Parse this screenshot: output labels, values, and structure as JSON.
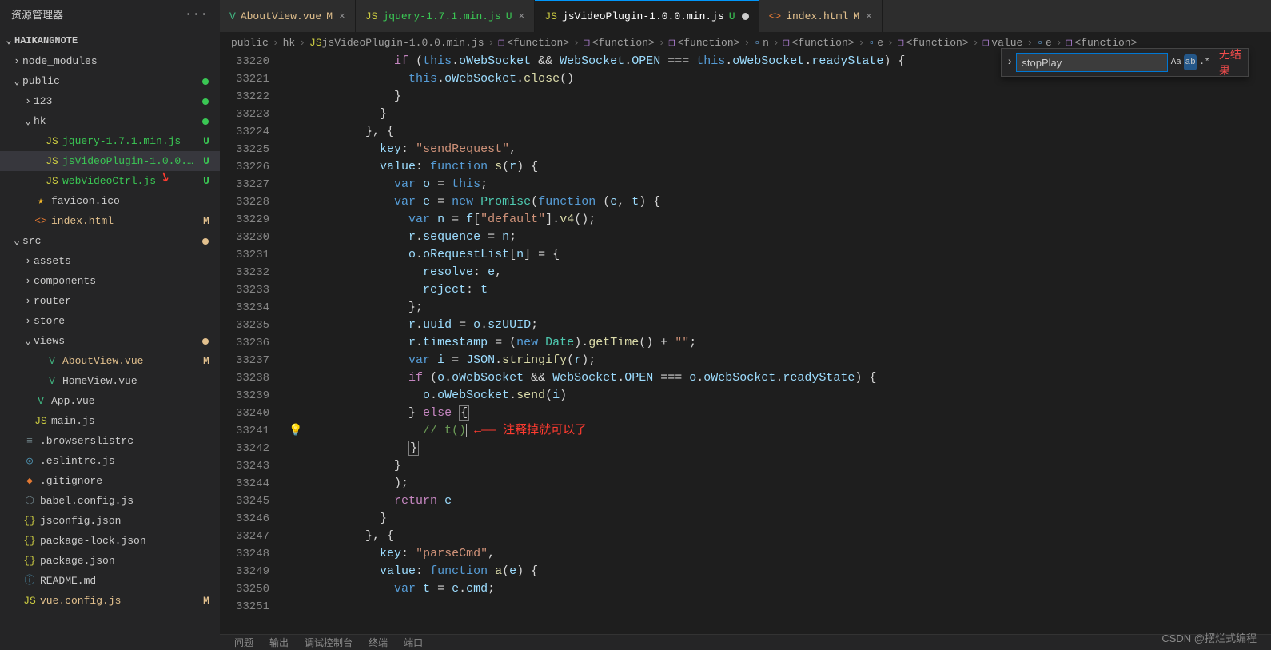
{
  "side": {
    "title": "资源管理器",
    "project": "HAIKANGNOTE",
    "tree": [
      {
        "ind": 14,
        "chev": "›",
        "icon": "",
        "name": "node_modules",
        "color": "",
        "badge": "",
        "dot": ""
      },
      {
        "ind": 14,
        "chev": "⌄",
        "icon": "",
        "name": "public",
        "color": "",
        "badge": "",
        "dot": "#3ac754"
      },
      {
        "ind": 28,
        "chev": "›",
        "icon": "",
        "name": "123",
        "color": "",
        "badge": "",
        "dot": "#3ac754"
      },
      {
        "ind": 28,
        "chev": "⌄",
        "icon": "",
        "name": "hk",
        "color": "",
        "badge": "",
        "dot": "#3ac754"
      },
      {
        "ind": 42,
        "chev": "",
        "icon": "JS",
        "iconcls": "js",
        "name": "jquery-1.7.1.min.js",
        "badge": "U",
        "bcolor": "#3ac754",
        "fg": "#3ac754"
      },
      {
        "ind": 42,
        "chev": "",
        "icon": "JS",
        "iconcls": "js",
        "name": "jsVideoPlugin-1.0.0.min.js",
        "badge": "U",
        "bcolor": "#3ac754",
        "fg": "#3ac754",
        "sel": true,
        "arrow": true
      },
      {
        "ind": 42,
        "chev": "",
        "icon": "JS",
        "iconcls": "js",
        "name": "webVideoCtrl.js",
        "badge": "U",
        "bcolor": "#3ac754",
        "fg": "#3ac754"
      },
      {
        "ind": 28,
        "chev": "",
        "icon": "★",
        "iconcls": "star",
        "name": "favicon.ico"
      },
      {
        "ind": 28,
        "chev": "",
        "icon": "<>",
        "iconcls": "orangef",
        "name": "index.html",
        "badge": "M",
        "bcolor": "#e2c08d",
        "fg": "#e2c08d"
      },
      {
        "ind": 14,
        "chev": "⌄",
        "icon": "",
        "name": "src",
        "badge": "",
        "dot": "#e2c08d"
      },
      {
        "ind": 28,
        "chev": "›",
        "icon": "",
        "name": "assets"
      },
      {
        "ind": 28,
        "chev": "›",
        "icon": "",
        "name": "components"
      },
      {
        "ind": 28,
        "chev": "›",
        "icon": "",
        "name": "router"
      },
      {
        "ind": 28,
        "chev": "›",
        "icon": "",
        "name": "store"
      },
      {
        "ind": 28,
        "chev": "⌄",
        "icon": "",
        "name": "views",
        "dot": "#e2c08d"
      },
      {
        "ind": 42,
        "chev": "",
        "icon": "V",
        "iconcls": "vue",
        "name": "AboutView.vue",
        "badge": "M",
        "bcolor": "#e2c08d",
        "fg": "#e2c08d"
      },
      {
        "ind": 42,
        "chev": "",
        "icon": "V",
        "iconcls": "vue",
        "name": "HomeView.vue"
      },
      {
        "ind": 28,
        "chev": "",
        "icon": "V",
        "iconcls": "vue",
        "name": "App.vue"
      },
      {
        "ind": 28,
        "chev": "",
        "icon": "JS",
        "iconcls": "js",
        "name": "main.js"
      },
      {
        "ind": 14,
        "chev": "",
        "icon": "≡",
        "iconcls": "gearc",
        "name": ".browserslistrc"
      },
      {
        "ind": 14,
        "chev": "",
        "icon": "◎",
        "iconcls": "oc",
        "name": ".eslintrc.js"
      },
      {
        "ind": 14,
        "chev": "",
        "icon": "◆",
        "iconcls": "orangef",
        "name": ".gitignore"
      },
      {
        "ind": 14,
        "chev": "",
        "icon": "⬡",
        "iconcls": "gearc",
        "name": "babel.config.js"
      },
      {
        "ind": 14,
        "chev": "",
        "icon": "{}",
        "iconcls": "brace",
        "name": "jsconfig.json"
      },
      {
        "ind": 14,
        "chev": "",
        "icon": "{}",
        "iconcls": "brace",
        "name": "package-lock.json"
      },
      {
        "ind": 14,
        "chev": "",
        "icon": "{}",
        "iconcls": "brace",
        "name": "package.json"
      },
      {
        "ind": 14,
        "chev": "",
        "icon": "ⓘ",
        "iconcls": "mdc",
        "name": "README.md"
      },
      {
        "ind": 14,
        "chev": "",
        "icon": "JS",
        "iconcls": "js",
        "name": "vue.config.js",
        "badge": "M",
        "bcolor": "#e2c08d",
        "fg": "#e2c08d"
      }
    ]
  },
  "tabs": [
    {
      "icon": "V",
      "iconcls": "vue",
      "name": "AboutView.vue",
      "sfx": "M",
      "sfxcolor": "#e2c08d",
      "close": "×",
      "fg": "#e2c08d"
    },
    {
      "icon": "JS",
      "iconcls": "js",
      "name": "jquery-1.7.1.min.js",
      "sfx": "U",
      "sfxcolor": "#3ac754",
      "close": "×",
      "fg": "#3ac754"
    },
    {
      "icon": "JS",
      "iconcls": "js",
      "name": "jsVideoPlugin-1.0.0.min.js",
      "sfx": "U",
      "sfxcolor": "#3ac754",
      "mod": true,
      "active": true,
      "fg": "#ffffff"
    },
    {
      "icon": "<>",
      "iconcls": "orangef",
      "name": "index.html",
      "sfx": "M",
      "sfxcolor": "#e2c08d",
      "close": "×",
      "fg": "#e2c08d"
    }
  ],
  "crumbs": [
    "public",
    "hk",
    "jsVideoPlugin-1.0.0.min.js",
    "<function>",
    "<function>",
    "<function>",
    "n",
    "<function>",
    "e",
    "<function>",
    "value",
    "e",
    "<function>"
  ],
  "search": {
    "value": "stopPlay",
    "opts": [
      "Aa",
      "ab",
      ".*"
    ],
    "nores": "无结果"
  },
  "lines_start": 33220,
  "lines": [
    "            <kw>if</kw> <p>(</p><this>this</this><p>.</p><prop>oWebSocket</prop> <p>&amp;&amp;</p> <prop>WebSocket</prop><p>.</p><prop>OPEN</prop> <p>===</p> <this>this</this><p>.</p><prop>oWebSocket</prop><p>.</p><prop>readyState</prop><p>) {</p>",
    "              <this>this</this><p>.</p><prop>oWebSocket</prop><p>.</p><def>close</def><p>()</p>",
    "            <p>}</p>",
    "          <p>}</p>",
    "        <p>}, {</p>",
    "          <prop>key</prop><p>:</p> <str>\"sendRequest\"</str><p>,</p>",
    "          <prop>value</prop><p>:</p> <kw2>function</kw2> <def>s</def><p>(</p><prop>r</prop><p>) {</p>",
    "            <kw2>var</kw2> <prop>o</prop> <p>=</p> <this>this</this><p>;</p>",
    "            <kw2>var</kw2> <prop>e</prop> <p>=</p> <kw2>new</kw2> <cls>Promise</cls><p>(</p><kw2>function</kw2> <p>(</p><prop>e</prop><p>,</p> <prop>t</prop><p>) {</p>",
    "              <kw2>var</kw2> <prop>n</prop> <p>=</p> <prop>f</prop><p>[</p><str>\"default\"</str><p>].</p><def>v4</def><p>();</p>",
    "              <prop>r</prop><p>.</p><prop>sequence</prop> <p>=</p> <prop>n</prop><p>;</p>",
    "              <prop>o</prop><p>.</p><prop>oRequestList</prop><p>[</p><prop>n</prop><p>] = {</p>",
    "                <prop>resolve</prop><p>:</p> <prop>e</prop><p>,</p>",
    "                <prop>reject</prop><p>:</p> <prop>t</prop>",
    "              <p>};</p>",
    "              <prop>r</prop><p>.</p><prop>uuid</prop> <p>=</p> <prop>o</prop><p>.</p><prop>szUUID</prop><p>;</p>",
    "              <prop>r</prop><p>.</p><prop>timestamp</prop> <p>=</p> <p>(</p><kw2>new</kw2> <cls>Date</cls><p>).</p><def>getTime</def><p>() +</p> <str>\"\"</str><p>;</p>",
    "              <kw2>var</kw2> <prop>i</prop> <p>=</p> <prop>JSON</prop><p>.</p><def>stringify</def><p>(</p><prop>r</prop><p>);</p>",
    "              <kw>if</kw> <p>(</p><prop>o</prop><p>.</p><prop>oWebSocket</prop> <p>&amp;&amp;</p> <prop>WebSocket</prop><p>.</p><prop>OPEN</prop> <p>===</p> <prop>o</prop><p>.</p><prop>oWebSocket</prop><p>.</p><prop>readyState</prop><p>) {</p>",
    "                <prop>o</prop><p>.</p><prop>oWebSocket</prop><p>.</p><def>send</def><p>(</p><prop>i</prop><p>)</p>",
    "              <p>}</p> <kw>else</kw> <span class=\"hlbox\"><p>{</p></span>",
    "                <cmt>// t()</cmt><span class=\"cursor\"></span> <redtxt>←—— 注释掉就可以了</redtxt>",
    "              <span class=\"hlbox\"><p>}</p></span>",
    "            <p>}</p>",
    "            <p>);</p>",
    "            <kw>return</kw> <prop>e</prop>",
    "          <p>}</p>",
    "        <p>}, {</p>",
    "          <prop>key</prop><p>:</p> <str>\"parseCmd\"</str><p>,</p>",
    "          <prop>value</prop><p>:</p> <kw2>function</kw2> <def>a</def><p>(</p><prop>e</prop><p>) {</p>",
    "            <kw2>var</kw2> <prop>t</prop> <p>=</p> <prop>e</prop><p>.</p><prop>cmd</prop><p>;</p>",
    "            "
  ],
  "bulb_line": 33241,
  "bottom_tabs": [
    "问题",
    "输出",
    "调试控制台",
    "终端",
    "端口"
  ],
  "watermark": "CSDN @摆烂式编程"
}
